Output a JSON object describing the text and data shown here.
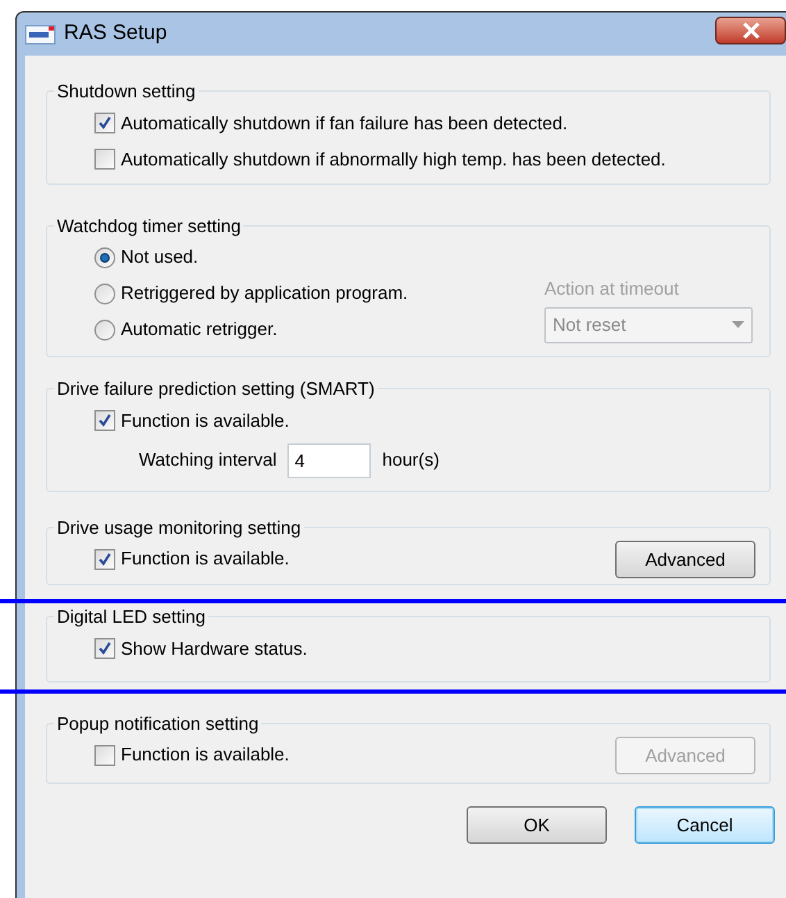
{
  "window": {
    "title": "RAS Setup"
  },
  "groups": [
    {
      "title": "Shutdown setting",
      "items": [
        {
          "kind": "checkbox",
          "label": "Automatically shutdown if fan failure has been detected.",
          "checked": true
        },
        {
          "kind": "checkbox",
          "label": "Automatically shutdown if abnormally high temp. has been detected.",
          "checked": false
        }
      ]
    },
    {
      "title": "Watchdog timer setting",
      "items": [
        {
          "kind": "radio",
          "label": "Not used.",
          "selected": true
        },
        {
          "kind": "radio",
          "label": "Retriggered by application program.",
          "selected": false
        },
        {
          "kind": "radio",
          "label": "Automatic retrigger.",
          "selected": false
        }
      ],
      "dropdown": {
        "label": "Action at timeout",
        "value": "Not reset",
        "disabled": true
      }
    },
    {
      "title": "Drive failure prediction setting (SMART)",
      "items": [
        {
          "kind": "checkbox",
          "label": "Function is available.",
          "checked": true
        },
        {
          "kind": "number",
          "label": "Watching interval",
          "value": "4",
          "unit": "hour(s)"
        }
      ]
    },
    {
      "title": "Drive usage monitoring setting",
      "items": [
        {
          "kind": "checkbox",
          "label": "Function is available.",
          "checked": true
        }
      ],
      "button": {
        "label": "Advanced",
        "disabled": false
      }
    },
    {
      "title": "Digital LED setting",
      "items": [
        {
          "kind": "checkbox",
          "label": "Show Hardware status.",
          "checked": true
        }
      ]
    },
    {
      "title": "Popup notification setting",
      "items": [
        {
          "kind": "checkbox",
          "label": "Function is available.",
          "checked": false
        }
      ],
      "button": {
        "label": "Advanced",
        "disabled": true
      }
    }
  ],
  "buttons": [
    {
      "label": "OK",
      "focused": false
    },
    {
      "label": "Cancel",
      "focused": true
    }
  ]
}
